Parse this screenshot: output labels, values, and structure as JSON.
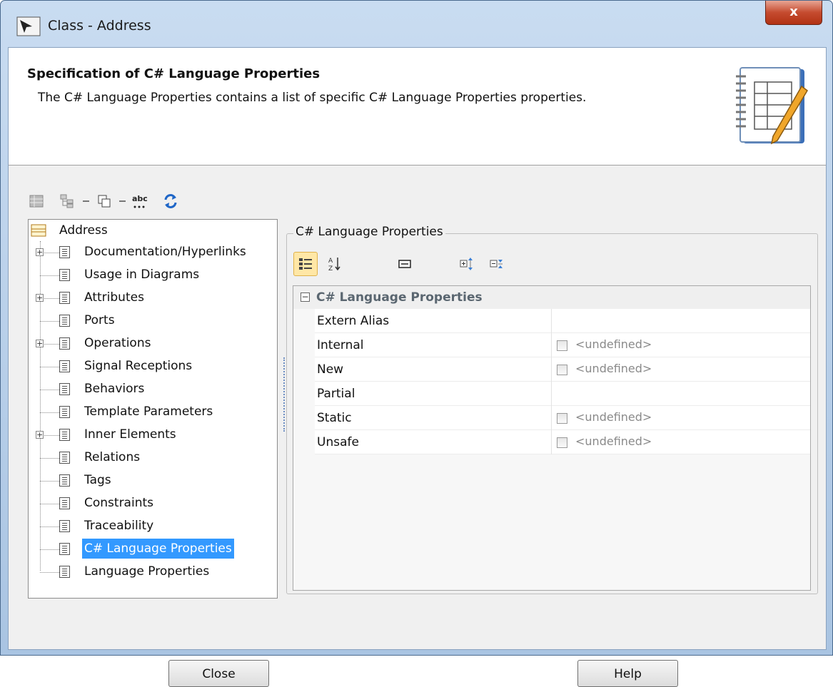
{
  "window": {
    "title": "Class - Address",
    "close_glyph": "x"
  },
  "header": {
    "title": "Specification of C# Language Properties",
    "description": "The C# Language Properties contains a list of specific C# Language Properties properties.",
    "icon": "notebook-pencil-icon"
  },
  "toolbar": {
    "icons": [
      "table-icon",
      "tree-icon",
      "copy-icon",
      "spell-check-icon",
      "refresh-icon"
    ]
  },
  "tree": {
    "root": "Address",
    "items": [
      {
        "label": "Documentation/Hyperlinks",
        "expandable": true
      },
      {
        "label": "Usage in Diagrams",
        "expandable": false
      },
      {
        "label": "Attributes",
        "expandable": true
      },
      {
        "label": "Ports",
        "expandable": false
      },
      {
        "label": "Operations",
        "expandable": true
      },
      {
        "label": "Signal Receptions",
        "expandable": false
      },
      {
        "label": "Behaviors",
        "expandable": false
      },
      {
        "label": "Template Parameters",
        "expandable": false
      },
      {
        "label": "Inner Elements",
        "expandable": true
      },
      {
        "label": "Relations",
        "expandable": false
      },
      {
        "label": "Tags",
        "expandable": false
      },
      {
        "label": "Constraints",
        "expandable": false
      },
      {
        "label": "Traceability",
        "expandable": false
      },
      {
        "label": "C# Language Properties",
        "expandable": false,
        "selected": true
      },
      {
        "label": "Language Properties",
        "expandable": false
      }
    ]
  },
  "properties": {
    "group_title": "C# Language Properties",
    "section_title": "C# Language Properties",
    "tools": [
      "categorized-icon",
      "sort-alpha-icon",
      "description-icon",
      "expand-all-icon",
      "collapse-all-icon"
    ],
    "rows": [
      {
        "name": "Extern Alias",
        "has_checkbox": false,
        "value": ""
      },
      {
        "name": "Internal",
        "has_checkbox": true,
        "value": "<undefined>"
      },
      {
        "name": "New",
        "has_checkbox": true,
        "value": "<undefined>"
      },
      {
        "name": "Partial",
        "has_checkbox": false,
        "value": ""
      },
      {
        "name": "Static",
        "has_checkbox": true,
        "value": "<undefined>"
      },
      {
        "name": "Unsafe",
        "has_checkbox": true,
        "value": "<undefined>"
      }
    ]
  },
  "buttons": {
    "close": "Close",
    "help": "Help"
  },
  "colors": {
    "selection": "#3399ff",
    "title_close": "#c54b2f"
  }
}
